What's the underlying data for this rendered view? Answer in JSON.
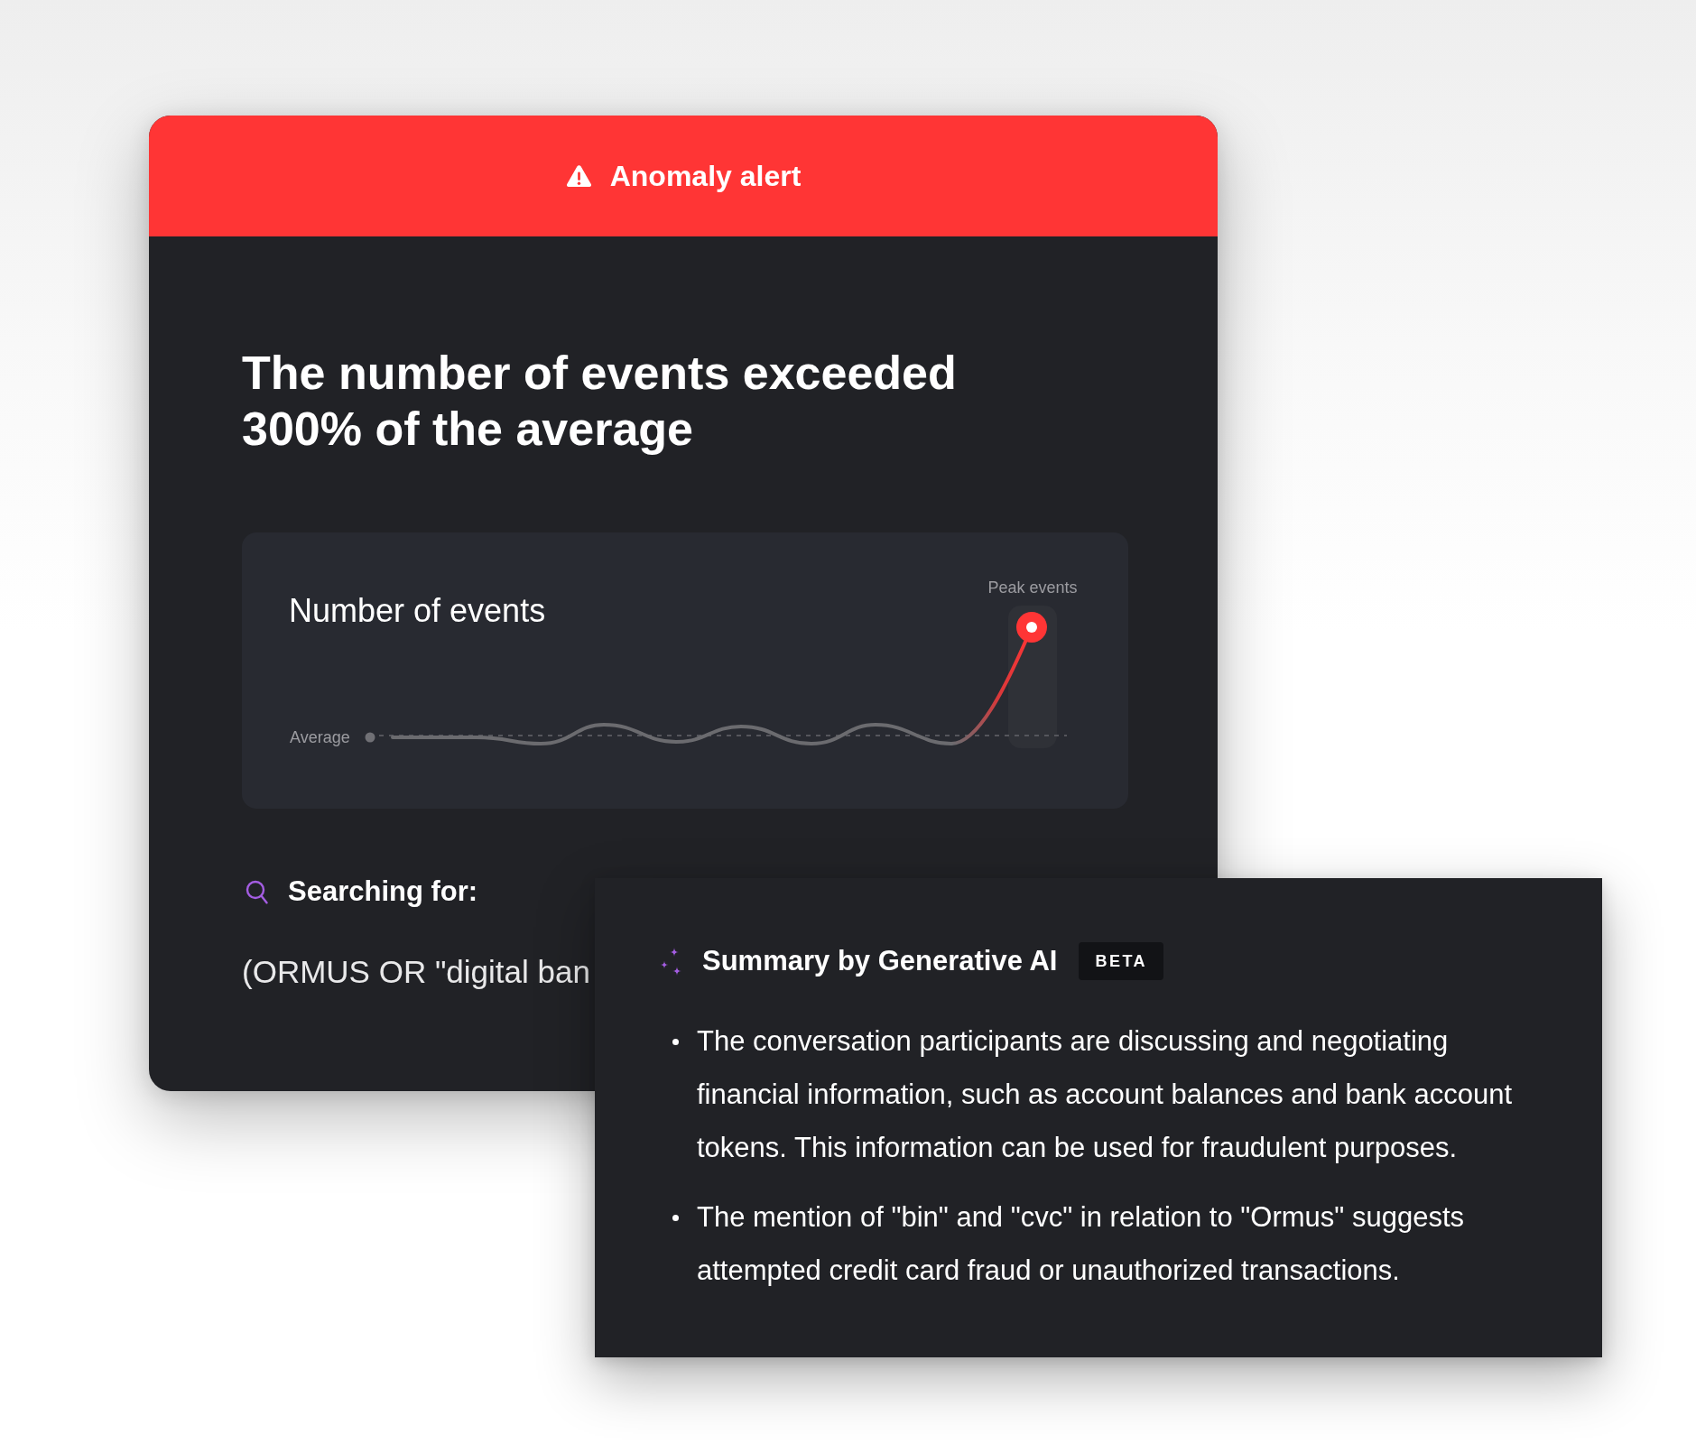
{
  "alert": {
    "title": "Anomaly alert"
  },
  "headline": "The number of events exceeded 300% of the average",
  "chart": {
    "title": "Number of events",
    "average_label": "Average",
    "peak_label": "Peak events"
  },
  "search": {
    "label": "Searching for:",
    "query": "(ORMUS OR \"digital ban"
  },
  "summary": {
    "title": "Summary by Generative AI",
    "badge": "BETA",
    "bullets": [
      "The conversation participants are discussing and negotiating financial information, such as account balances and bank account tokens. This information can be used for fraudulent purposes.",
      "The mention of \"bin\" and \"cvc\" in relation to \"Ormus\" suggests attempted credit card fraud or unauthorized transactions."
    ]
  }
}
